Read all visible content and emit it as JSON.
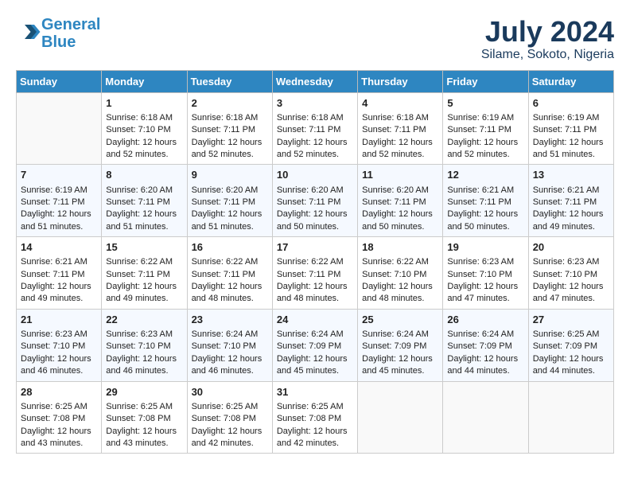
{
  "header": {
    "logo_line1": "General",
    "logo_line2": "Blue",
    "month_year": "July 2024",
    "location": "Silame, Sokoto, Nigeria"
  },
  "days_of_week": [
    "Sunday",
    "Monday",
    "Tuesday",
    "Wednesday",
    "Thursday",
    "Friday",
    "Saturday"
  ],
  "weeks": [
    [
      {
        "day": "",
        "empty": true
      },
      {
        "day": "1",
        "sunrise": "6:18 AM",
        "sunset": "7:10 PM",
        "daylight": "12 hours and 52 minutes."
      },
      {
        "day": "2",
        "sunrise": "6:18 AM",
        "sunset": "7:11 PM",
        "daylight": "12 hours and 52 minutes."
      },
      {
        "day": "3",
        "sunrise": "6:18 AM",
        "sunset": "7:11 PM",
        "daylight": "12 hours and 52 minutes."
      },
      {
        "day": "4",
        "sunrise": "6:18 AM",
        "sunset": "7:11 PM",
        "daylight": "12 hours and 52 minutes."
      },
      {
        "day": "5",
        "sunrise": "6:19 AM",
        "sunset": "7:11 PM",
        "daylight": "12 hours and 52 minutes."
      },
      {
        "day": "6",
        "sunrise": "6:19 AM",
        "sunset": "7:11 PM",
        "daylight": "12 hours and 51 minutes."
      }
    ],
    [
      {
        "day": "7",
        "sunrise": "6:19 AM",
        "sunset": "7:11 PM",
        "daylight": "12 hours and 51 minutes."
      },
      {
        "day": "8",
        "sunrise": "6:20 AM",
        "sunset": "7:11 PM",
        "daylight": "12 hours and 51 minutes."
      },
      {
        "day": "9",
        "sunrise": "6:20 AM",
        "sunset": "7:11 PM",
        "daylight": "12 hours and 51 minutes."
      },
      {
        "day": "10",
        "sunrise": "6:20 AM",
        "sunset": "7:11 PM",
        "daylight": "12 hours and 50 minutes."
      },
      {
        "day": "11",
        "sunrise": "6:20 AM",
        "sunset": "7:11 PM",
        "daylight": "12 hours and 50 minutes."
      },
      {
        "day": "12",
        "sunrise": "6:21 AM",
        "sunset": "7:11 PM",
        "daylight": "12 hours and 50 minutes."
      },
      {
        "day": "13",
        "sunrise": "6:21 AM",
        "sunset": "7:11 PM",
        "daylight": "12 hours and 49 minutes."
      }
    ],
    [
      {
        "day": "14",
        "sunrise": "6:21 AM",
        "sunset": "7:11 PM",
        "daylight": "12 hours and 49 minutes."
      },
      {
        "day": "15",
        "sunrise": "6:22 AM",
        "sunset": "7:11 PM",
        "daylight": "12 hours and 49 minutes."
      },
      {
        "day": "16",
        "sunrise": "6:22 AM",
        "sunset": "7:11 PM",
        "daylight": "12 hours and 48 minutes."
      },
      {
        "day": "17",
        "sunrise": "6:22 AM",
        "sunset": "7:11 PM",
        "daylight": "12 hours and 48 minutes."
      },
      {
        "day": "18",
        "sunrise": "6:22 AM",
        "sunset": "7:10 PM",
        "daylight": "12 hours and 48 minutes."
      },
      {
        "day": "19",
        "sunrise": "6:23 AM",
        "sunset": "7:10 PM",
        "daylight": "12 hours and 47 minutes."
      },
      {
        "day": "20",
        "sunrise": "6:23 AM",
        "sunset": "7:10 PM",
        "daylight": "12 hours and 47 minutes."
      }
    ],
    [
      {
        "day": "21",
        "sunrise": "6:23 AM",
        "sunset": "7:10 PM",
        "daylight": "12 hours and 46 minutes."
      },
      {
        "day": "22",
        "sunrise": "6:23 AM",
        "sunset": "7:10 PM",
        "daylight": "12 hours and 46 minutes."
      },
      {
        "day": "23",
        "sunrise": "6:24 AM",
        "sunset": "7:10 PM",
        "daylight": "12 hours and 46 minutes."
      },
      {
        "day": "24",
        "sunrise": "6:24 AM",
        "sunset": "7:09 PM",
        "daylight": "12 hours and 45 minutes."
      },
      {
        "day": "25",
        "sunrise": "6:24 AM",
        "sunset": "7:09 PM",
        "daylight": "12 hours and 45 minutes."
      },
      {
        "day": "26",
        "sunrise": "6:24 AM",
        "sunset": "7:09 PM",
        "daylight": "12 hours and 44 minutes."
      },
      {
        "day": "27",
        "sunrise": "6:25 AM",
        "sunset": "7:09 PM",
        "daylight": "12 hours and 44 minutes."
      }
    ],
    [
      {
        "day": "28",
        "sunrise": "6:25 AM",
        "sunset": "7:08 PM",
        "daylight": "12 hours and 43 minutes."
      },
      {
        "day": "29",
        "sunrise": "6:25 AM",
        "sunset": "7:08 PM",
        "daylight": "12 hours and 43 minutes."
      },
      {
        "day": "30",
        "sunrise": "6:25 AM",
        "sunset": "7:08 PM",
        "daylight": "12 hours and 42 minutes."
      },
      {
        "day": "31",
        "sunrise": "6:25 AM",
        "sunset": "7:08 PM",
        "daylight": "12 hours and 42 minutes."
      },
      {
        "day": "",
        "empty": true
      },
      {
        "day": "",
        "empty": true
      },
      {
        "day": "",
        "empty": true
      }
    ]
  ]
}
